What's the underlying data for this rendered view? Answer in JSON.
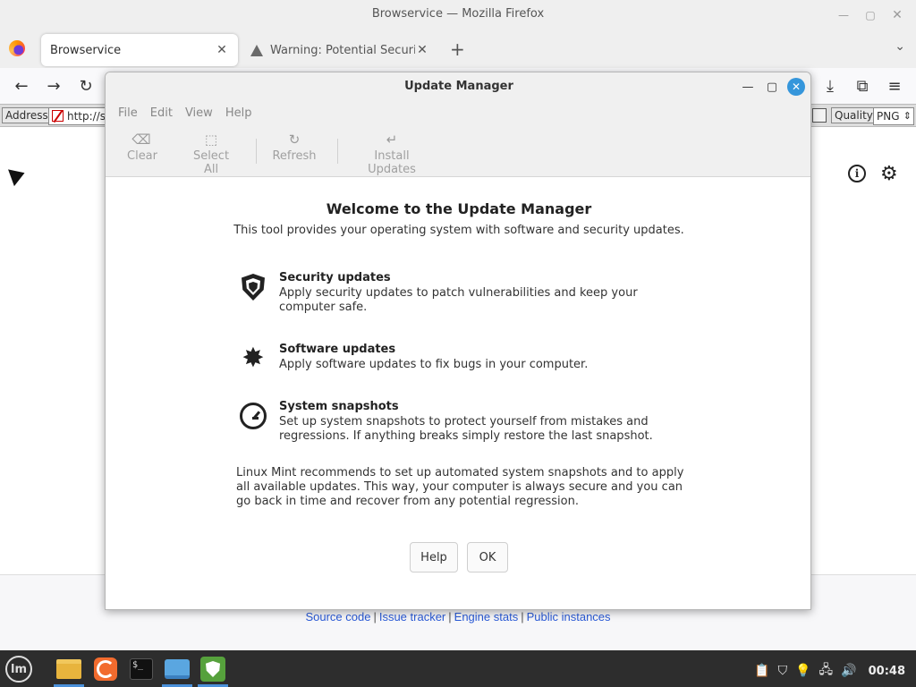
{
  "firefox": {
    "window_title": "Browservice — Mozilla Firefox",
    "tabs": [
      {
        "label": "Browservice"
      },
      {
        "label": "Warning: Potential Security"
      }
    ],
    "new_tab_symbol": "+",
    "address_label": "Address",
    "address_value": "http://s",
    "quality_label": "Quality",
    "quality_value": "PNG",
    "footer_links": [
      "Source code",
      "Issue tracker",
      "Engine stats",
      "Public instances"
    ],
    "footer_separator": "|"
  },
  "dialog": {
    "title": "Update Manager",
    "menu": [
      "File",
      "Edit",
      "View",
      "Help"
    ],
    "toolbar": {
      "clear": "Clear",
      "select_all": "Select All",
      "refresh": "Refresh",
      "install_updates": "Install Updates"
    },
    "welcome_title": "Welcome to the Update Manager",
    "welcome_subtitle": "This tool provides your operating system with software and security updates.",
    "features": [
      {
        "title": "Security updates",
        "description": "Apply security updates to patch vulnerabilities and keep your computer safe.",
        "icon": "shield-icon"
      },
      {
        "title": "Software updates",
        "description": "Apply software updates to fix bugs in your computer.",
        "icon": "starburst-arrow-icon"
      },
      {
        "title": "System snapshots",
        "description": "Set up system snapshots to protect yourself from mistakes and regressions. If anything breaks simply restore the last snapshot.",
        "icon": "clock-icon"
      }
    ],
    "recommendation": "Linux Mint recommends to set up automated system snapshots and to apply all available updates. This way, your computer is always secure and you can go back in time and recover from any potential regression.",
    "buttons": {
      "help": "Help",
      "ok": "OK"
    },
    "close_color": "#3596db"
  },
  "taskbar": {
    "menu_logo_text": "lm",
    "terminal_prompt": "$_",
    "clock": "00:48",
    "accent": "#4a90d9"
  }
}
